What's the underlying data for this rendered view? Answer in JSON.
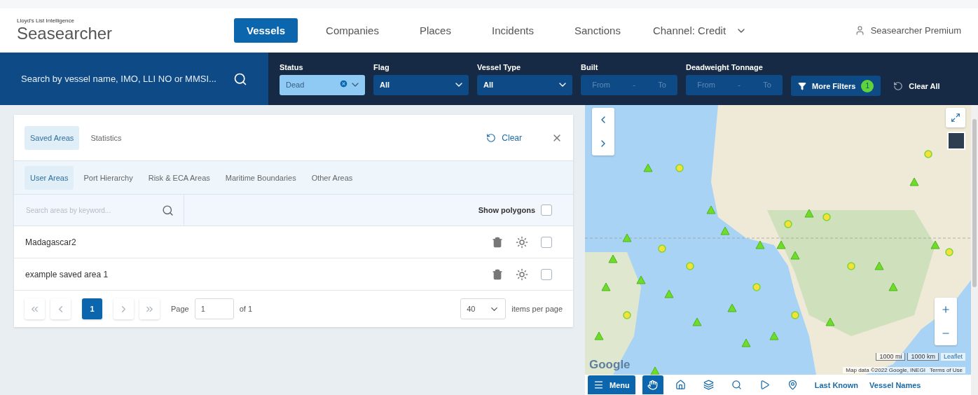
{
  "brand": {
    "company": "Lloyd's List Intelligence",
    "product": "Seasearcher"
  },
  "nav": [
    {
      "label": "Vessels",
      "selected": true
    },
    {
      "label": "Companies",
      "selected": false
    },
    {
      "label": "Places",
      "selected": false
    },
    {
      "label": "Incidents",
      "selected": false
    },
    {
      "label": "Sanctions",
      "selected": false
    }
  ],
  "channel": "Channel: Credit",
  "user": "Seasearcher Premium",
  "search": {
    "placeholder": "Search by vessel name, IMO, LLI NO or MMSI..."
  },
  "filters": [
    {
      "kind": "select",
      "label": "Status",
      "value": "Dead",
      "active": true
    },
    {
      "kind": "select",
      "label": "Flag",
      "value": "All",
      "active": false
    },
    {
      "kind": "select",
      "label": "Vessel Type",
      "value": "All",
      "active": false
    },
    {
      "kind": "range",
      "label": "Built",
      "from": "From",
      "separator": "-",
      "to": "To"
    },
    {
      "kind": "range",
      "label": "Deadweight Tonnage",
      "from": "From",
      "separator": "-",
      "to": "To"
    }
  ],
  "more_filters": {
    "label": "More Filters",
    "count": "1"
  },
  "clear_all": "Clear All",
  "panel": {
    "tabs": [
      {
        "label": "Saved Areas",
        "selected": true
      },
      {
        "label": "Statistics",
        "selected": false
      }
    ],
    "clear": "Clear",
    "subtabs": [
      {
        "label": "User Areas",
        "selected": true
      },
      {
        "label": "Port Hierarchy",
        "selected": false
      },
      {
        "label": "Risk & ECA Areas",
        "selected": false
      },
      {
        "label": "Maritime Boundaries",
        "selected": false
      },
      {
        "label": "Other Areas",
        "selected": false
      }
    ],
    "search_placeholder": "Search areas by keyword...",
    "show_polygons": {
      "label": "Show polygons",
      "checked": false
    },
    "rows": [
      {
        "name": "Madagascar2",
        "checked": false
      },
      {
        "name": "example saved area 1",
        "checked": false
      }
    ],
    "pagination": {
      "pages": [
        {
          "label": "1",
          "selected": true
        }
      ],
      "page_label": "Page",
      "page_value": "1",
      "of": "of 1",
      "per_page": "40",
      "per_page_label": "items per page"
    }
  },
  "map": {
    "logo": "Google",
    "scale": [
      "1000 mi",
      "1000 km"
    ],
    "leaflet": "Leaflet",
    "attribution": "Map data ©2022 Google, INEGI",
    "terms": "Terms of Use",
    "toolbar": {
      "menu": "Menu",
      "tools": [
        {
          "kind": "hand",
          "selected": true
        },
        {
          "kind": "add-area",
          "selected": false
        },
        {
          "kind": "layers",
          "selected": false
        },
        {
          "kind": "search",
          "selected": false
        },
        {
          "kind": "play",
          "selected": false
        },
        {
          "kind": "pin",
          "selected": false
        }
      ],
      "links": [
        "Last Known",
        "Vessel Names"
      ]
    }
  }
}
